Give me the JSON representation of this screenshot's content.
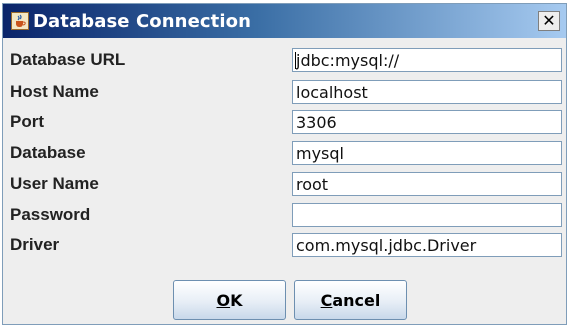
{
  "window": {
    "title": "Database Connection"
  },
  "form": {
    "rows": [
      {
        "label": "Database URL",
        "value": "jdbc:mysql://"
      },
      {
        "label": "Host Name",
        "value": "localhost"
      },
      {
        "label": "Port",
        "value": "3306"
      },
      {
        "label": "Database",
        "value": "mysql"
      },
      {
        "label": "User Name",
        "value": "root"
      },
      {
        "label": "Password",
        "value": ""
      },
      {
        "label": "Driver",
        "value": "com.mysql.jdbc.Driver"
      }
    ]
  },
  "buttons": {
    "ok": {
      "mnemonic": "O",
      "rest": "K"
    },
    "cancel": {
      "mnemonic": "C",
      "rest": "ancel"
    }
  },
  "icons": {
    "app": "java-cup-icon",
    "close": "close-icon"
  }
}
